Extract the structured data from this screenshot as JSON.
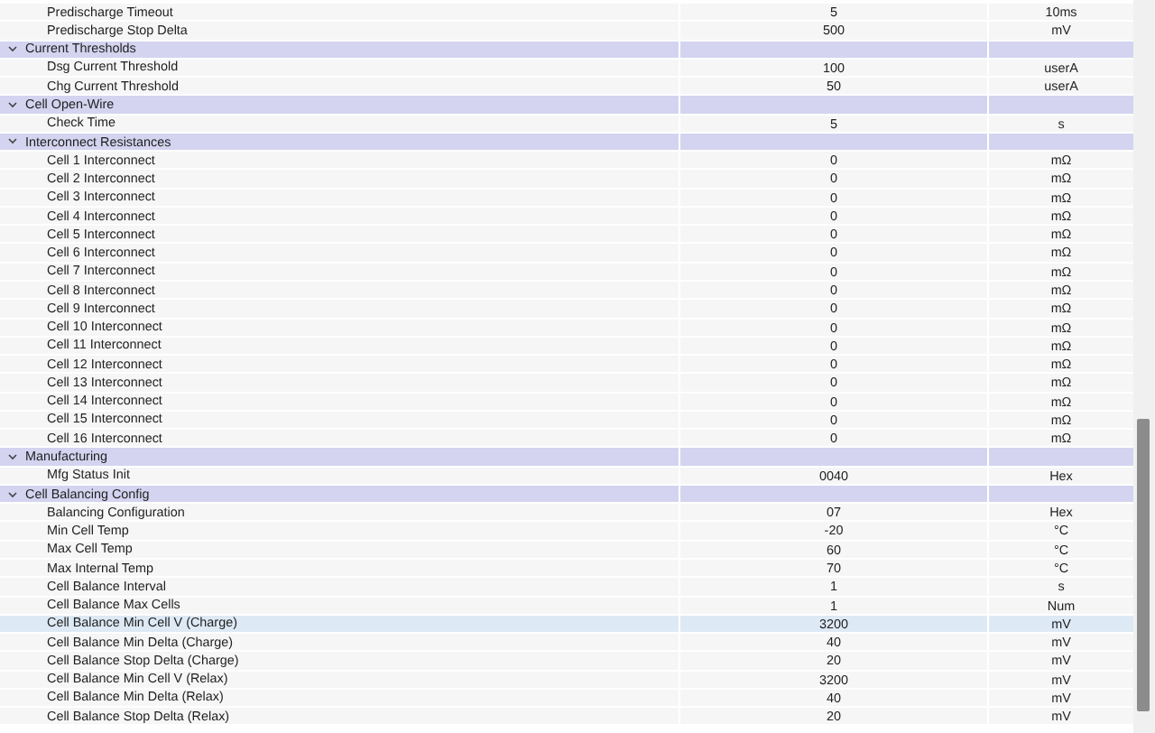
{
  "rows": [
    {
      "name": "Predischarge Timeout",
      "value": "5",
      "unit": "10ms",
      "selected": false
    },
    {
      "name": "Predischarge Stop Delta",
      "value": "500",
      "unit": "mV",
      "selected": false
    }
  ],
  "groups": [
    {
      "label": "Current Thresholds",
      "expanded": true,
      "rows": [
        {
          "name": "Dsg Current Threshold",
          "value": "100",
          "unit": "userA",
          "selected": false
        },
        {
          "name": "Chg Current Threshold",
          "value": "50",
          "unit": "userA",
          "selected": false
        }
      ]
    },
    {
      "label": "Cell Open-Wire",
      "expanded": true,
      "rows": [
        {
          "name": "Check Time",
          "value": "5",
          "unit": "s",
          "selected": false
        }
      ]
    },
    {
      "label": "Interconnect Resistances",
      "expanded": true,
      "rows": [
        {
          "name": "Cell 1 Interconnect",
          "value": "0",
          "unit": "mΩ",
          "selected": false
        },
        {
          "name": "Cell 2 Interconnect",
          "value": "0",
          "unit": "mΩ",
          "selected": false
        },
        {
          "name": "Cell 3 Interconnect",
          "value": "0",
          "unit": "mΩ",
          "selected": false
        },
        {
          "name": "Cell 4 Interconnect",
          "value": "0",
          "unit": "mΩ",
          "selected": false
        },
        {
          "name": "Cell 5 Interconnect",
          "value": "0",
          "unit": "mΩ",
          "selected": false
        },
        {
          "name": "Cell 6 Interconnect",
          "value": "0",
          "unit": "mΩ",
          "selected": false
        },
        {
          "name": "Cell 7 Interconnect",
          "value": "0",
          "unit": "mΩ",
          "selected": false
        },
        {
          "name": "Cell 8 Interconnect",
          "value": "0",
          "unit": "mΩ",
          "selected": false
        },
        {
          "name": "Cell 9 Interconnect",
          "value": "0",
          "unit": "mΩ",
          "selected": false
        },
        {
          "name": "Cell 10 Interconnect",
          "value": "0",
          "unit": "mΩ",
          "selected": false
        },
        {
          "name": "Cell 11 Interconnect",
          "value": "0",
          "unit": "mΩ",
          "selected": false
        },
        {
          "name": "Cell 12 Interconnect",
          "value": "0",
          "unit": "mΩ",
          "selected": false
        },
        {
          "name": "Cell 13 Interconnect",
          "value": "0",
          "unit": "mΩ",
          "selected": false
        },
        {
          "name": "Cell 14 Interconnect",
          "value": "0",
          "unit": "mΩ",
          "selected": false
        },
        {
          "name": "Cell 15 Interconnect",
          "value": "0",
          "unit": "mΩ",
          "selected": false
        },
        {
          "name": "Cell 16 Interconnect",
          "value": "0",
          "unit": "mΩ",
          "selected": false
        }
      ]
    },
    {
      "label": "Manufacturing",
      "expanded": true,
      "rows": [
        {
          "name": "Mfg Status Init",
          "value": "0040",
          "unit": "Hex",
          "selected": false
        }
      ]
    },
    {
      "label": "Cell Balancing Config",
      "expanded": true,
      "rows": [
        {
          "name": "Balancing Configuration",
          "value": "07",
          "unit": "Hex",
          "selected": false
        },
        {
          "name": "Min Cell Temp",
          "value": "-20",
          "unit": "°C",
          "selected": false
        },
        {
          "name": "Max Cell Temp",
          "value": "60",
          "unit": "°C",
          "selected": false
        },
        {
          "name": "Max Internal Temp",
          "value": "70",
          "unit": "°C",
          "selected": false
        },
        {
          "name": "Cell Balance Interval",
          "value": "1",
          "unit": "s",
          "selected": false
        },
        {
          "name": "Cell Balance Max Cells",
          "value": "1",
          "unit": "Num",
          "selected": false
        },
        {
          "name": "Cell Balance Min Cell V (Charge)",
          "value": "3200",
          "unit": "mV",
          "selected": true
        },
        {
          "name": "Cell Balance Min Delta (Charge)",
          "value": "40",
          "unit": "mV",
          "selected": false
        },
        {
          "name": "Cell Balance Stop Delta (Charge)",
          "value": "20",
          "unit": "mV",
          "selected": false
        },
        {
          "name": "Cell Balance Min Cell V (Relax)",
          "value": "3200",
          "unit": "mV",
          "selected": false
        },
        {
          "name": "Cell Balance Min Delta (Relax)",
          "value": "40",
          "unit": "mV",
          "selected": false
        },
        {
          "name": "Cell Balance Stop Delta (Relax)",
          "value": "20",
          "unit": "mV",
          "selected": false
        }
      ]
    }
  ]
}
